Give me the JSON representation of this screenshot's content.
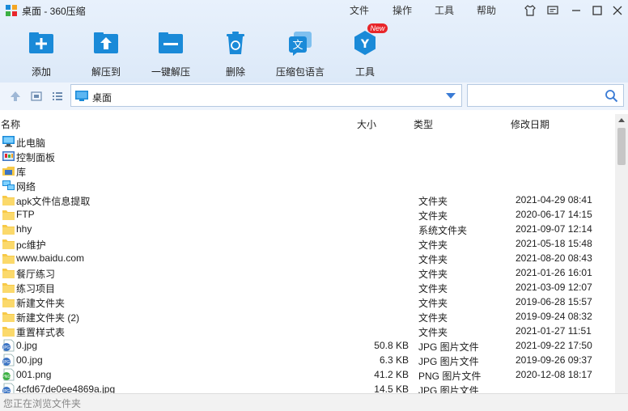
{
  "window": {
    "title": "桌面 - 360压缩"
  },
  "menu": [
    "文件",
    "操作",
    "工具",
    "帮助"
  ],
  "toolbar": {
    "add": "添加",
    "extract_to": "解压到",
    "one_click_extract": "一键解压",
    "delete": "删除",
    "archive_language": "压缩包语言",
    "tools": "工具",
    "new_badge": "New",
    "lang_glyph": "文",
    "tools_glyph": "Y"
  },
  "path": {
    "current": "桌面"
  },
  "search": {
    "value": "",
    "placeholder": ""
  },
  "columns": {
    "name": "名称",
    "size": "大小",
    "type": "类型",
    "modified": "修改日期"
  },
  "files": [
    {
      "icon": "computer-icon",
      "name": "此电脑",
      "size": "",
      "type": "",
      "modified": ""
    },
    {
      "icon": "control-panel-icon",
      "name": "控制面板",
      "size": "",
      "type": "",
      "modified": ""
    },
    {
      "icon": "library-icon",
      "name": "库",
      "size": "",
      "type": "",
      "modified": ""
    },
    {
      "icon": "network-icon",
      "name": "网络",
      "size": "",
      "type": "",
      "modified": ""
    },
    {
      "icon": "folder-icon",
      "name": "apk文件信息提取",
      "size": "",
      "type": "文件夹",
      "modified": "2021-04-29 08:41"
    },
    {
      "icon": "folder-icon",
      "name": "FTP",
      "size": "",
      "type": "文件夹",
      "modified": "2020-06-17 14:15"
    },
    {
      "icon": "folder-icon",
      "name": "hhy",
      "size": "",
      "type": "系统文件夹",
      "modified": "2021-09-07 12:14"
    },
    {
      "icon": "folder-icon",
      "name": "pc维护",
      "size": "",
      "type": "文件夹",
      "modified": "2021-05-18 15:48"
    },
    {
      "icon": "folder-icon",
      "name": "www.baidu.com",
      "size": "",
      "type": "文件夹",
      "modified": "2021-08-20 08:43"
    },
    {
      "icon": "folder-icon",
      "name": "餐厅练习",
      "size": "",
      "type": "文件夹",
      "modified": "2021-01-26 16:01"
    },
    {
      "icon": "folder-icon",
      "name": "练习项目",
      "size": "",
      "type": "文件夹",
      "modified": "2021-03-09 12:07"
    },
    {
      "icon": "folder-icon",
      "name": "新建文件夹",
      "size": "",
      "type": "文件夹",
      "modified": "2019-06-28 15:57"
    },
    {
      "icon": "folder-icon",
      "name": "新建文件夹 (2)",
      "size": "",
      "type": "文件夹",
      "modified": "2019-09-24 08:32"
    },
    {
      "icon": "folder-icon",
      "name": "重置样式表",
      "size": "",
      "type": "文件夹",
      "modified": "2021-01-27 11:51"
    },
    {
      "icon": "jpg-file-icon",
      "name": "0.jpg",
      "size": "50.8 KB",
      "type": "JPG 图片文件",
      "modified": "2021-09-22 17:50"
    },
    {
      "icon": "jpg-file-icon",
      "name": "00.jpg",
      "size": "6.3 KB",
      "type": "JPG 图片文件",
      "modified": "2019-09-26 09:37"
    },
    {
      "icon": "png-file-icon",
      "name": "001.png",
      "size": "41.2 KB",
      "type": "PNG 图片文件",
      "modified": "2020-12-08 18:17"
    },
    {
      "icon": "jpg-file-icon",
      "name": "4cfd67de0ee4869a.jpg",
      "size": "14.5 KB",
      "type": "JPG 图片文件",
      "modified": ""
    }
  ],
  "status": {
    "text": "您正在浏览文件夹"
  },
  "colors": {
    "accent": "#1a8ad8",
    "folder": "#f7c948",
    "badge": "#e8262a",
    "toolbar_bg": "#dce9f8"
  }
}
